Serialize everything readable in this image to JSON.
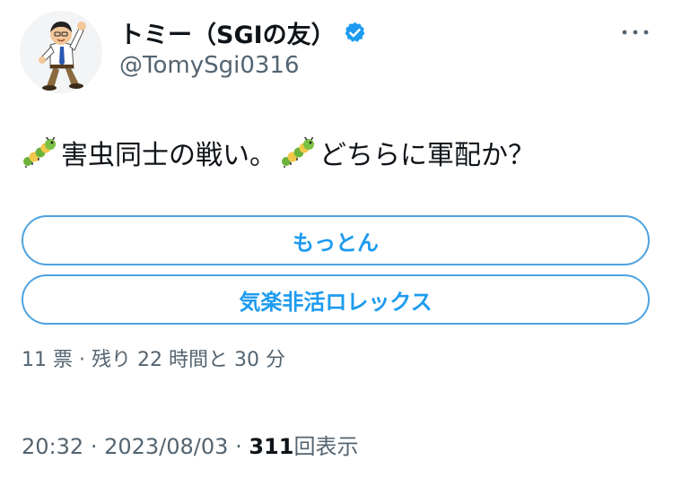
{
  "author": {
    "display_name": "トミー（SGIの友）",
    "handle": "@TomySgi0316",
    "verified": true,
    "avatar_icon": "cartoon-man-avatar-icon",
    "verified_icon": "verified-badge-icon",
    "more_icon": "more-options-icon"
  },
  "tweet": {
    "text_parts": [
      "害虫同士の戦い。",
      "どちらに軍配か？"
    ],
    "emoji": "caterpillar-emoji-icon"
  },
  "poll": {
    "options": [
      {
        "label": "もっとん"
      },
      {
        "label": "気楽非活ロレックス"
      }
    ],
    "votes_text": "11 票",
    "separator": "·",
    "remaining_text": "残り 22 時間と 30 分"
  },
  "meta": {
    "time": "20:32",
    "date": "2023/08/03",
    "separator": "·",
    "views_count": "311",
    "views_label": "回表示"
  },
  "colors": {
    "accent": "#1d9bf0",
    "secondary_text": "#536471",
    "primary_text": "#0f1419",
    "verified": "#1d9bf0"
  }
}
